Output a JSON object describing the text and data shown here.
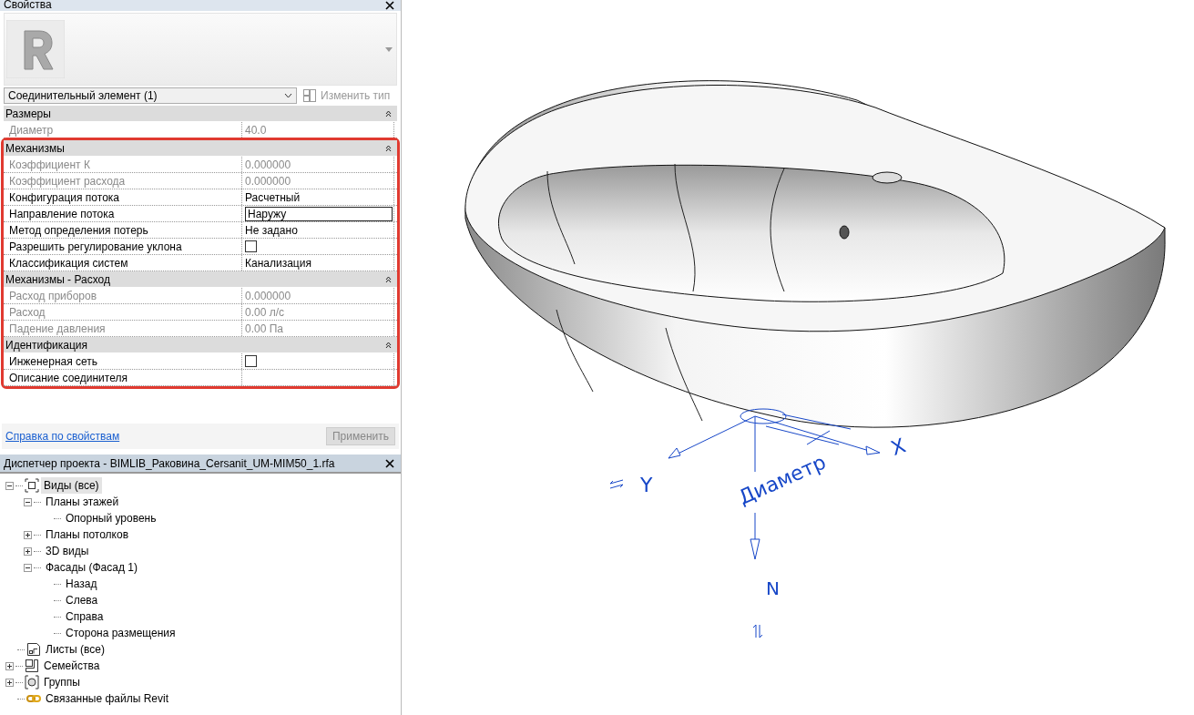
{
  "properties": {
    "title": "Свойства",
    "type_selector": {
      "value": "Соединительный элемент (1)"
    },
    "edit_type_button": {
      "label": "Изменить тип",
      "disabled": true
    },
    "groups": [
      {
        "name": "Размеры",
        "highlighted": false,
        "rows": [
          {
            "label": "Диаметр",
            "value": "40.0",
            "kind": "text",
            "readonly": true
          }
        ]
      },
      {
        "name": "Механизмы",
        "highlighted": true,
        "rows": [
          {
            "label": "Коэффициент К",
            "value": "0.000000",
            "kind": "text",
            "readonly": true
          },
          {
            "label": "Коэффициент расхода",
            "value": "0.000000",
            "kind": "text",
            "readonly": true
          },
          {
            "label": "Конфигурация потока",
            "value": "Расчетный",
            "kind": "text",
            "readonly": false
          },
          {
            "label": "Направление потока",
            "value": "Наружу",
            "kind": "field",
            "readonly": false
          },
          {
            "label": "Метод определения потерь",
            "value": "Не задано",
            "kind": "text",
            "readonly": false
          },
          {
            "label": "Разрешить регулирование уклона",
            "kind": "checkbox",
            "checked": false,
            "readonly": false
          },
          {
            "label": "Классификация систем",
            "value": "Канализация",
            "kind": "text",
            "readonly": false
          }
        ]
      },
      {
        "name": "Механизмы - Расход",
        "highlighted": true,
        "rows": [
          {
            "label": "Расход приборов",
            "value": "0.000000",
            "kind": "text",
            "readonly": true
          },
          {
            "label": "Расход",
            "value": "0.00 л/с",
            "kind": "text",
            "readonly": true
          },
          {
            "label": "Падение давления",
            "value": "0.00 Па",
            "kind": "text",
            "readonly": true
          }
        ]
      },
      {
        "name": "Идентификация",
        "highlighted": true,
        "rows": [
          {
            "label": "Инженерная сеть",
            "kind": "checkbox",
            "checked": false,
            "readonly": false
          },
          {
            "label": "Описание соединителя",
            "kind": "empty",
            "readonly": false
          }
        ]
      }
    ],
    "help_link": "Справка по свойствам",
    "apply_button": {
      "label": "Применить",
      "disabled": true
    }
  },
  "project_browser": {
    "title": "Диспетчер проекта - BIMLIB_Раковина_Cersanit_UM-MIM50_1.rfa",
    "tree": [
      {
        "label": "Виды (все)",
        "kind": "views",
        "expanded": true,
        "selected": true,
        "children": [
          {
            "label": "Планы этажей",
            "expanded": true,
            "selected": false,
            "children": [
              {
                "label": "Опорный уровень",
                "selected": false
              }
            ]
          },
          {
            "label": "Планы потолков",
            "expanded": false,
            "selected": false
          },
          {
            "label": "3D виды",
            "expanded": false,
            "selected": false
          },
          {
            "label": "Фасады (Фасад 1)",
            "expanded": true,
            "selected": false,
            "children": [
              {
                "label": "Назад",
                "selected": false
              },
              {
                "label": "Слева",
                "selected": false
              },
              {
                "label": "Справа",
                "selected": false
              },
              {
                "label": "Сторона размещения",
                "selected": false
              }
            ]
          }
        ]
      },
      {
        "label": "Листы (все)",
        "kind": "sheets",
        "selected": false
      },
      {
        "label": "Семейства",
        "kind": "families",
        "expanded": false,
        "selected": false
      },
      {
        "label": "Группы",
        "kind": "groups",
        "expanded": false,
        "selected": false
      },
      {
        "label": "Связанные файлы Revit",
        "kind": "links",
        "selected": false
      }
    ]
  },
  "viewport": {
    "y_axis": "Y",
    "x_axis": "X",
    "z_axis": "N",
    "dimension": "Диаметр"
  }
}
